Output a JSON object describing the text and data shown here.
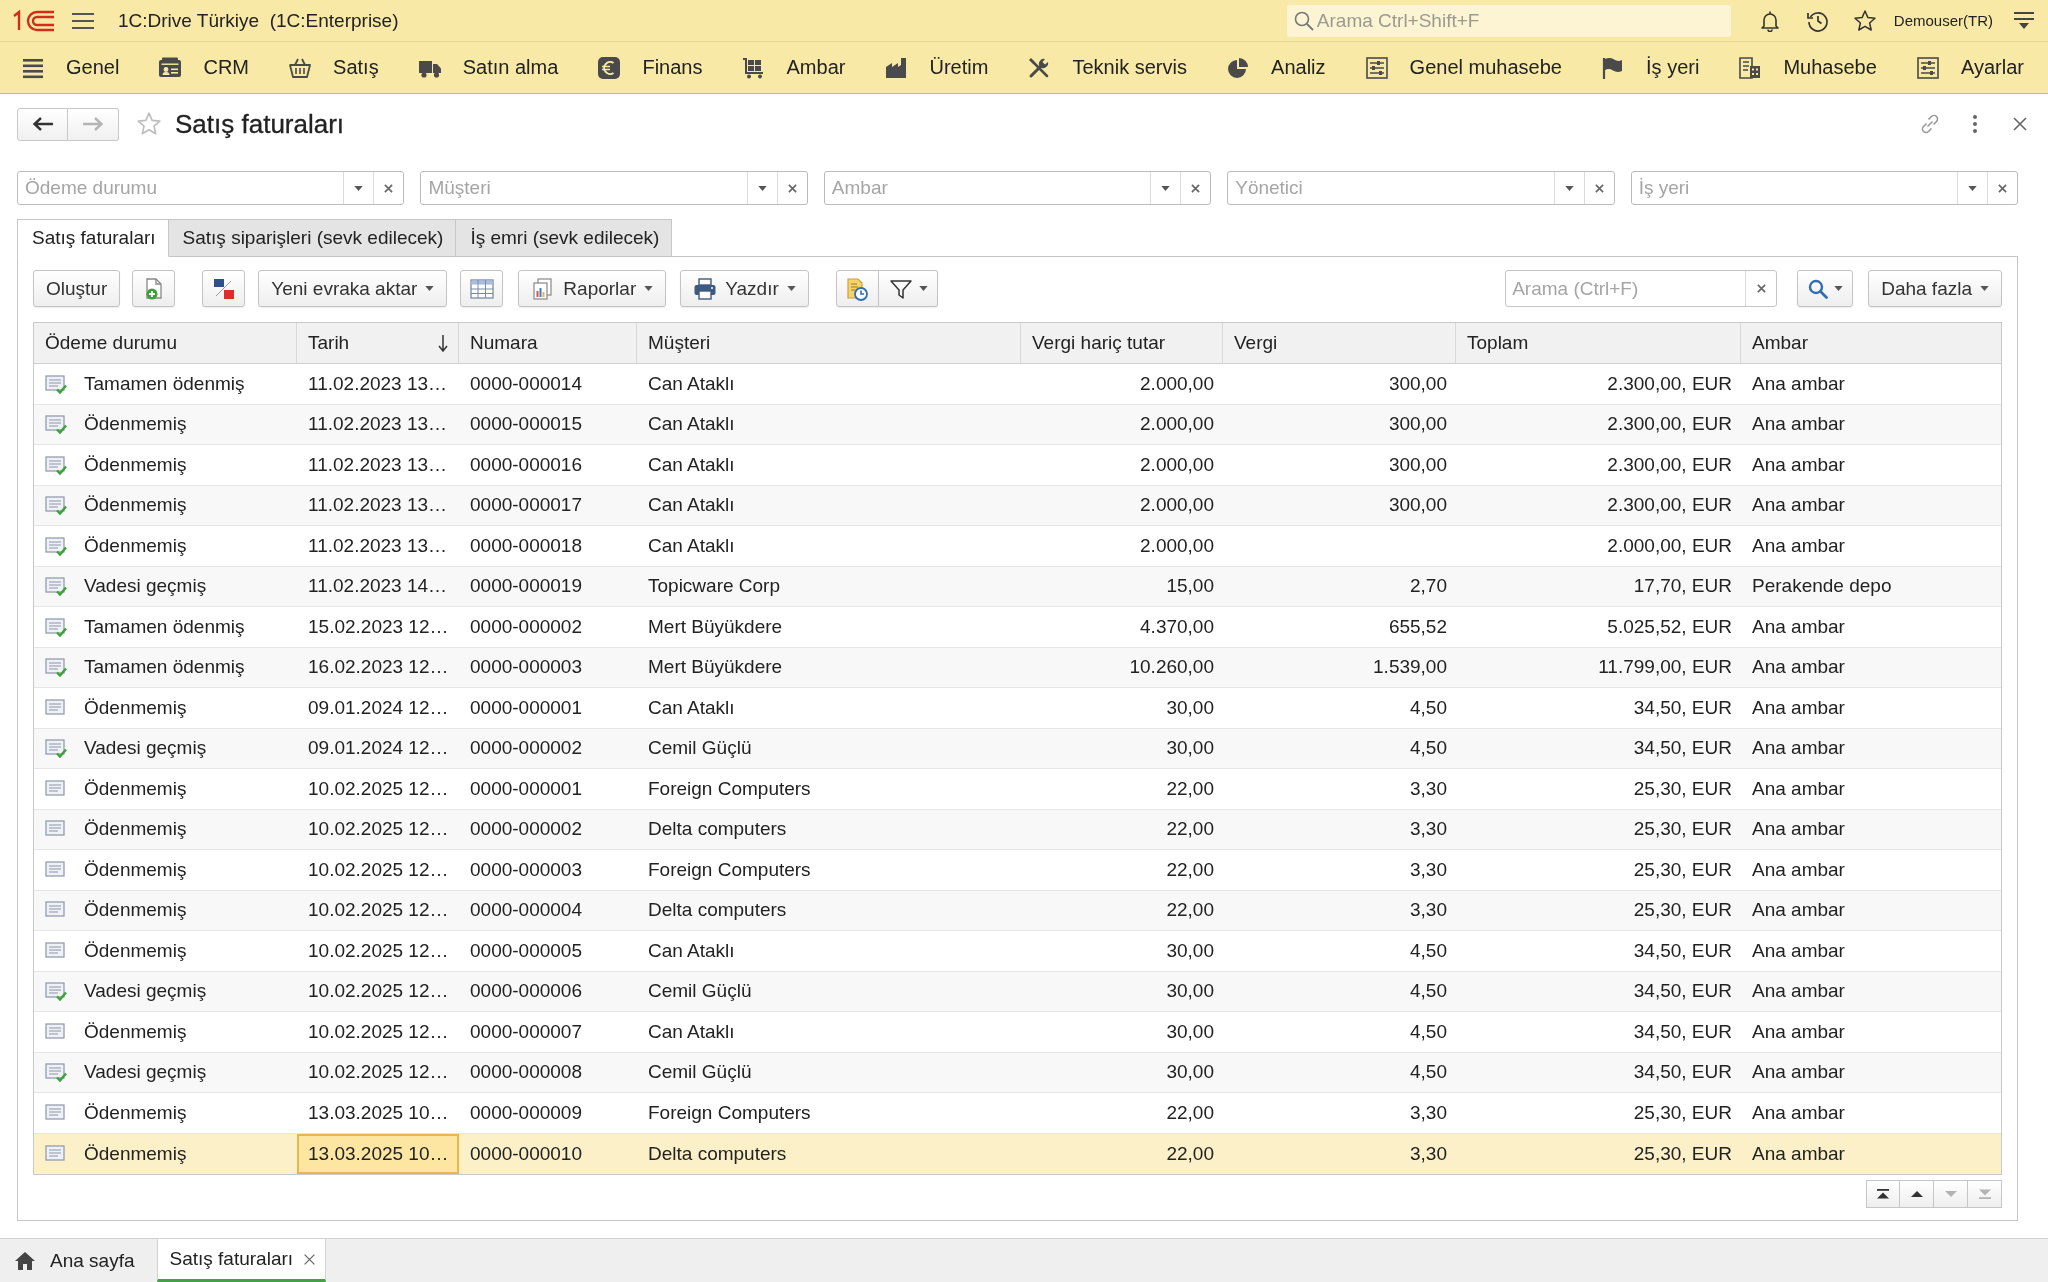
{
  "app_bar": {
    "title": "1C:Drive Türkiye  (1C:Enterprise)",
    "search": {
      "placeholder": "Arama Ctrl+Shift+F"
    },
    "user": "Demouser(TR)"
  },
  "sections": [
    {
      "label": "Genel"
    },
    {
      "label": "CRM"
    },
    {
      "label": "Satış"
    },
    {
      "label": "Satın alma"
    },
    {
      "label": "Finans"
    },
    {
      "label": "Ambar"
    },
    {
      "label": "Üretim"
    },
    {
      "label": "Teknik servis"
    },
    {
      "label": "Analiz"
    },
    {
      "label": "Genel muhasebe"
    },
    {
      "label": "İş yeri"
    },
    {
      "label": "Muhasebe"
    },
    {
      "label": "Ayarlar"
    }
  ],
  "page": {
    "title": "Satış faturaları",
    "favorite": false,
    "back_enabled": true,
    "forward_enabled": false
  },
  "filters": [
    {
      "placeholder": "Ödeme durumu"
    },
    {
      "placeholder": "Müşteri"
    },
    {
      "placeholder": "Ambar"
    },
    {
      "placeholder": "Yönetici"
    },
    {
      "placeholder": "İş yeri"
    }
  ],
  "tabs": [
    {
      "label": "Satış faturaları",
      "selected": true
    },
    {
      "label": "Satış siparişleri (sevk edilecek)",
      "selected": false
    },
    {
      "label": "İş emri (sevk edilecek)",
      "selected": false
    }
  ],
  "toolbar": {
    "items": [
      {
        "kind": "button",
        "label": "Oluştur"
      },
      {
        "kind": "icon"
      },
      {
        "kind": "icon"
      },
      {
        "kind": "menu",
        "label": "Yeni evraka aktar"
      },
      {
        "kind": "icon"
      },
      {
        "kind": "icon-menu",
        "label": "Raporlar"
      },
      {
        "kind": "icon-menu",
        "label": "Yazdır"
      },
      {
        "kind": "icon"
      },
      {
        "kind": "icon-caret"
      }
    ],
    "search": {
      "placeholder": "Arama (Ctrl+F)"
    },
    "more": "Daha fazla"
  },
  "table": {
    "columns": [
      {
        "label": "Ödeme durumu",
        "kind": "text",
        "sorted": false,
        "current": false
      },
      {
        "label": "Tarih",
        "kind": "text",
        "sorted": true,
        "current": true
      },
      {
        "label": "Numara",
        "kind": "text",
        "sorted": false,
        "current": false
      },
      {
        "label": "Müşteri",
        "kind": "text",
        "sorted": false,
        "current": false
      },
      {
        "label": "Vergi hariç tutar",
        "kind": "number",
        "sorted": false,
        "current": false
      },
      {
        "label": "Vergi",
        "kind": "number",
        "sorted": false,
        "current": false
      },
      {
        "label": "Toplam",
        "kind": "number",
        "sorted": false,
        "current": false
      },
      {
        "label": "Ambar",
        "kind": "text",
        "sorted": false,
        "current": false
      }
    ],
    "rows": [
      {
        "posted": true,
        "selected": false,
        "cells": [
          "Tamamen ödenmiş",
          "11.02.2023 13…",
          "0000-000014",
          "Can Ataklı",
          "2.000,00",
          "300,00",
          "2.300,00, EUR",
          "Ana ambar"
        ]
      },
      {
        "posted": true,
        "selected": false,
        "cells": [
          "Ödenmemiş",
          "11.02.2023 13…",
          "0000-000015",
          "Can Ataklı",
          "2.000,00",
          "300,00",
          "2.300,00, EUR",
          "Ana ambar"
        ]
      },
      {
        "posted": true,
        "selected": false,
        "cells": [
          "Ödenmemiş",
          "11.02.2023 13…",
          "0000-000016",
          "Can Ataklı",
          "2.000,00",
          "300,00",
          "2.300,00, EUR",
          "Ana ambar"
        ]
      },
      {
        "posted": true,
        "selected": false,
        "cells": [
          "Ödenmemiş",
          "11.02.2023 13…",
          "0000-000017",
          "Can Ataklı",
          "2.000,00",
          "300,00",
          "2.300,00, EUR",
          "Ana ambar"
        ]
      },
      {
        "posted": true,
        "selected": false,
        "cells": [
          "Ödenmemiş",
          "11.02.2023 13…",
          "0000-000018",
          "Can Ataklı",
          "2.000,00",
          null,
          "2.000,00, EUR",
          "Ana ambar"
        ]
      },
      {
        "posted": true,
        "selected": false,
        "cells": [
          "Vadesi geçmiş",
          "11.02.2023 14…",
          "0000-000019",
          "Topicware Corp",
          "15,00",
          "2,70",
          "17,70, EUR",
          "Perakende depo"
        ]
      },
      {
        "posted": true,
        "selected": false,
        "cells": [
          "Tamamen ödenmiş",
          "15.02.2023 12…",
          "0000-000002",
          "Mert Büyükdere",
          "4.370,00",
          "655,52",
          "5.025,52, EUR",
          "Ana ambar"
        ]
      },
      {
        "posted": true,
        "selected": false,
        "cells": [
          "Tamamen ödenmiş",
          "16.02.2023 12…",
          "0000-000003",
          "Mert Büyükdere",
          "10.260,00",
          "1.539,00",
          "11.799,00, EUR",
          "Ana ambar"
        ]
      },
      {
        "posted": false,
        "selected": false,
        "cells": [
          "Ödenmemiş",
          "09.01.2024 12…",
          "0000-000001",
          "Can Ataklı",
          "30,00",
          "4,50",
          "34,50, EUR",
          "Ana ambar"
        ]
      },
      {
        "posted": true,
        "selected": false,
        "cells": [
          "Vadesi geçmiş",
          "09.01.2024 12…",
          "0000-000002",
          "Cemil Güçlü",
          "30,00",
          "4,50",
          "34,50, EUR",
          "Ana ambar"
        ]
      },
      {
        "posted": false,
        "selected": false,
        "cells": [
          "Ödenmemiş",
          "10.02.2025 12…",
          "0000-000001",
          "Foreign Computers",
          "22,00",
          "3,30",
          "25,30, EUR",
          "Ana ambar"
        ]
      },
      {
        "posted": false,
        "selected": false,
        "cells": [
          "Ödenmemiş",
          "10.02.2025 12…",
          "0000-000002",
          "Delta computers",
          "22,00",
          "3,30",
          "25,30, EUR",
          "Ana ambar"
        ]
      },
      {
        "posted": false,
        "selected": false,
        "cells": [
          "Ödenmemiş",
          "10.02.2025 12…",
          "0000-000003",
          "Foreign Computers",
          "22,00",
          "3,30",
          "25,30, EUR",
          "Ana ambar"
        ]
      },
      {
        "posted": false,
        "selected": false,
        "cells": [
          "Ödenmemiş",
          "10.02.2025 12…",
          "0000-000004",
          "Delta computers",
          "22,00",
          "3,30",
          "25,30, EUR",
          "Ana ambar"
        ]
      },
      {
        "posted": false,
        "selected": false,
        "cells": [
          "Ödenmemiş",
          "10.02.2025 12…",
          "0000-000005",
          "Can Ataklı",
          "30,00",
          "4,50",
          "34,50, EUR",
          "Ana ambar"
        ]
      },
      {
        "posted": true,
        "selected": false,
        "cells": [
          "Vadesi geçmiş",
          "10.02.2025 12…",
          "0000-000006",
          "Cemil Güçlü",
          "30,00",
          "4,50",
          "34,50, EUR",
          "Ana ambar"
        ]
      },
      {
        "posted": false,
        "selected": false,
        "cells": [
          "Ödenmemiş",
          "10.02.2025 12…",
          "0000-000007",
          "Can Ataklı",
          "30,00",
          "4,50",
          "34,50, EUR",
          "Ana ambar"
        ]
      },
      {
        "posted": true,
        "selected": false,
        "cells": [
          "Vadesi geçmiş",
          "10.02.2025 12…",
          "0000-000008",
          "Cemil Güçlü",
          "30,00",
          "4,50",
          "34,50, EUR",
          "Ana ambar"
        ]
      },
      {
        "posted": false,
        "selected": false,
        "cells": [
          "Ödenmemiş",
          "13.03.2025 10…",
          "0000-000009",
          "Foreign Computers",
          "22,00",
          "3,30",
          "25,30, EUR",
          "Ana ambar"
        ]
      },
      {
        "posted": false,
        "selected": true,
        "cells": [
          "Ödenmemiş",
          "13.03.2025 10…",
          "0000-000010",
          "Delta computers",
          "22,00",
          "3,30",
          "25,30, EUR",
          "Ana ambar"
        ]
      }
    ]
  },
  "pager": [
    {
      "disabled": false
    },
    {
      "disabled": false
    },
    {
      "disabled": true
    },
    {
      "disabled": true
    }
  ],
  "window_tabs": [
    {
      "kind": "home",
      "label": "Ana sayfa",
      "selected": false
    },
    {
      "kind": "document",
      "label": "Satış faturaları",
      "selected": true
    }
  ]
}
